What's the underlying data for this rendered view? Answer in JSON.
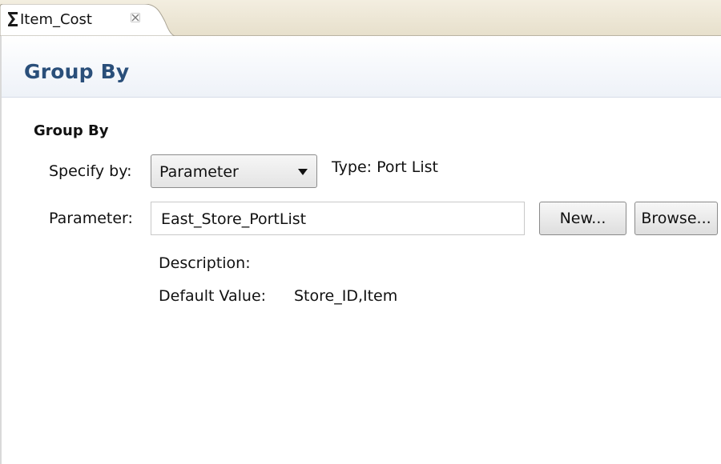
{
  "tab": {
    "title": "Item_Cost",
    "icon": "sigma-icon",
    "close_icon": "close-icon"
  },
  "page": {
    "title": "Group By"
  },
  "section": {
    "title": "Group By",
    "specify_by": {
      "label": "Specify by:",
      "selected": "Parameter"
    },
    "type_text": "Type: Port List",
    "parameter": {
      "label": "Parameter:",
      "value": "East_Store_PortList",
      "new_button": "New...",
      "browse_button": "Browse..."
    },
    "description_label": "Description:",
    "default_value_label": "Default Value:",
    "default_value": "Store_ID,Item"
  },
  "colors": {
    "title_blue": "#2a4f7a",
    "tab_strip": "#e7e0cc"
  }
}
